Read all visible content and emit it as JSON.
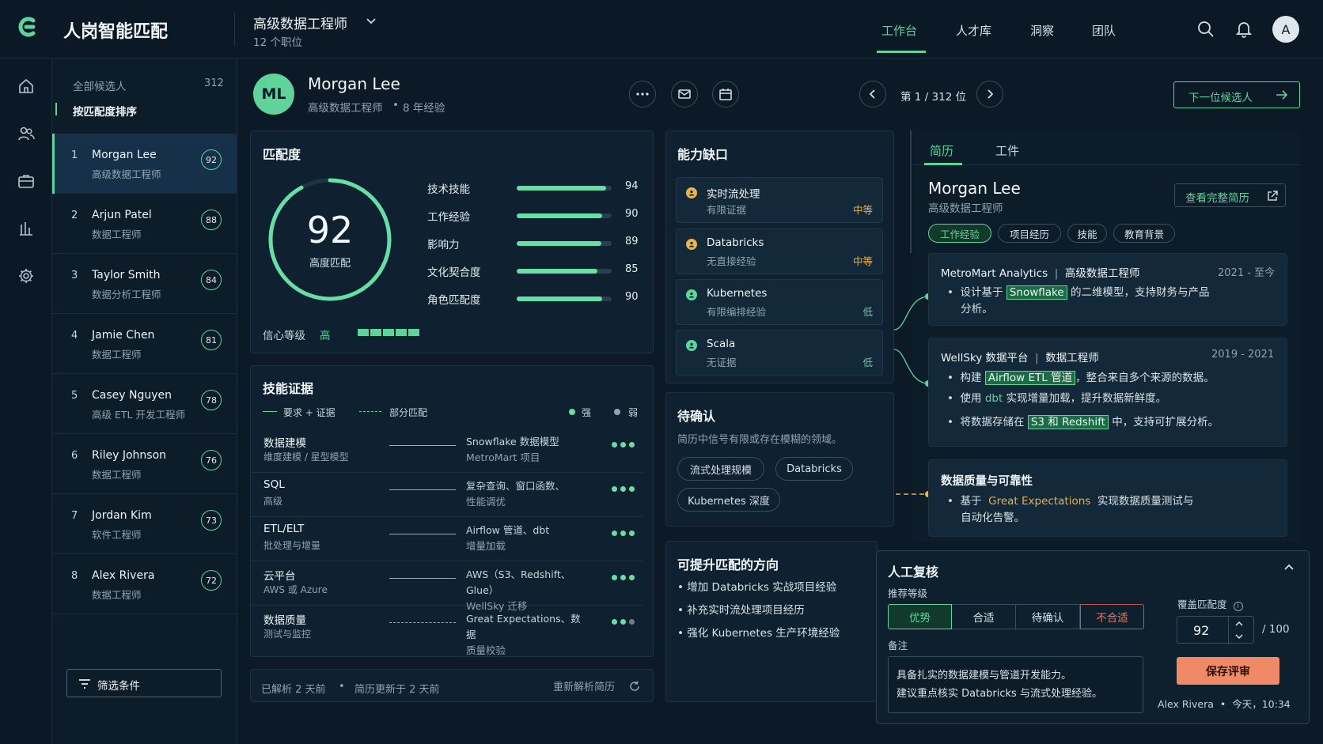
{
  "app": {
    "name": "人岗智能匹配"
  },
  "job": {
    "title": "高级数据工程师",
    "subtitle": "12 个职位"
  },
  "nav": {
    "items": [
      "工作台",
      "人才库",
      "洞察",
      "团队"
    ],
    "active": 0
  },
  "user": {
    "avatar": "A"
  },
  "sidebar_icons": [
    "home-icon",
    "users-icon",
    "briefcase-icon",
    "chart-icon",
    "gear-icon"
  ],
  "candidates_panel": {
    "all_label": "全部候选人",
    "count": "312",
    "sort_label": "按匹配度排序",
    "filter_label": "筛选条件",
    "list": [
      {
        "rank": "1",
        "name": "Morgan Lee",
        "role": "高级数据工程师",
        "score": "92"
      },
      {
        "rank": "2",
        "name": "Arjun Patel",
        "role": "数据工程师",
        "score": "88"
      },
      {
        "rank": "3",
        "name": "Taylor Smith",
        "role": "数据分析工程师",
        "score": "84"
      },
      {
        "rank": "4",
        "name": "Jamie Chen",
        "role": "数据工程师",
        "score": "81"
      },
      {
        "rank": "5",
        "name": "Casey Nguyen",
        "role": "高级 ETL 开发工程师",
        "score": "78"
      },
      {
        "rank": "6",
        "name": "Riley Johnson",
        "role": "数据工程师",
        "score": "76"
      },
      {
        "rank": "7",
        "name": "Jordan Kim",
        "role": "软件工程师",
        "score": "73"
      },
      {
        "rank": "8",
        "name": "Alex Rivera",
        "role": "数据工程师",
        "score": "72"
      }
    ]
  },
  "candidate": {
    "initials": "ML",
    "name": "Morgan Lee",
    "role": "高级数据工程师",
    "experience": "8 年经验",
    "pager": "第 1 / 312 位",
    "next_label": "下一位候选人"
  },
  "match": {
    "title": "匹配度",
    "score": 92,
    "score_text": "92",
    "score_label": "高度匹配",
    "confidence_label": "信心等级",
    "confidence_value": "高",
    "confidence_segments": 5,
    "bars": [
      {
        "label": "技术技能",
        "value": 94,
        "value_text": "94"
      },
      {
        "label": "工作经验",
        "value": 90,
        "value_text": "90"
      },
      {
        "label": "影响力",
        "value": 89,
        "value_text": "89"
      },
      {
        "label": "文化契合度",
        "value": 85,
        "value_text": "85"
      },
      {
        "label": "角色匹配度",
        "value": 90,
        "value_text": "90"
      }
    ]
  },
  "evidence": {
    "title": "技能证据",
    "legend_solid": "要求 + 证据",
    "legend_dashed": "部分匹配",
    "legend_strong": "强",
    "legend_weak": "弱",
    "rows": [
      {
        "skill": "数据建模",
        "sub": "维度建模 / 星型模型",
        "ev1": "Snowflake 数据模型",
        "ev2": "MetroMart 项目",
        "strength": 3
      },
      {
        "skill": "SQL",
        "sub": "高级",
        "ev1": "复杂查询、窗口函数、",
        "ev2": "性能调优",
        "strength": 3
      },
      {
        "skill": "ETL/ELT",
        "sub": "批处理与增量",
        "ev1": "Airflow 管道、dbt",
        "ev2": "增量加载",
        "strength": 3
      },
      {
        "skill": "云平台",
        "sub": "AWS 或 Azure",
        "ev1": "AWS（S3、Redshift、Glue）",
        "ev2": "WellSky 迁移",
        "strength": 3
      },
      {
        "skill": "数据质量",
        "sub": "测试与监控",
        "ev1": "Great Expectations、数据",
        "ev2": "质量校验",
        "strength": 2
      }
    ],
    "footer_parsed": "已解析 2 天前",
    "footer_updated": "简历更新于 2 天前",
    "reparse_label": "重新解析简历"
  },
  "gaps": {
    "title": "能力缺口",
    "items": [
      {
        "name": "实时流处理",
        "desc": "有限证据",
        "level": "中等",
        "color": "#e5b450"
      },
      {
        "name": "Databricks",
        "desc": "无直接经验",
        "level": "中等",
        "color": "#e5b450"
      },
      {
        "name": "Kubernetes",
        "desc": "有限编排经验",
        "level": "低",
        "color": "#5fd39a"
      },
      {
        "name": "Scala",
        "desc": "无证据",
        "level": "低",
        "color": "#5fd39a"
      }
    ]
  },
  "pending": {
    "title": "待确认",
    "desc": "简历中信号有限或存在模糊的领域。",
    "chips": [
      "流式处理规模",
      "Databricks",
      "Kubernetes 深度"
    ]
  },
  "improve": {
    "title": "可提升匹配的方向",
    "items": [
      "增加 Databricks 实战项目经验",
      "补充实时流处理项目经历",
      "强化 Kubernetes 生产环境经验"
    ]
  },
  "resume": {
    "tabs": [
      "简历",
      "工件"
    ],
    "name": "Morgan Lee",
    "role": "高级数据工程师",
    "view_full": "查看完整简历",
    "filters": [
      "工作经验",
      "项目经历",
      "技能",
      "教育背景"
    ],
    "jobs": [
      {
        "company": "MetroMart Analytics",
        "title": "高级数据工程师",
        "period": "2021 - 至今",
        "b1_pre": "设计基于",
        "b1_hl": "Snowflake",
        "b1_post": "的二维模型，支持财务与产品",
        "b1_cont": "分析。"
      },
      {
        "company": "WellSky 数据平台",
        "title": "数据工程师",
        "period": "2019 - 2021",
        "b1_pre": "构建",
        "b1_hl": "Airflow ETL 管道",
        "b1_post": "，整合来自多个来源的数据。",
        "b2_pre": "使用",
        "b2_hl": "dbt",
        "b2_post": "实现增量加载，提升数据新鲜度。",
        "b3_pre": "将数据存储在",
        "b3_hl": "S3 和 Redshift",
        "b3_post": "中，支持可扩展分析。"
      }
    ],
    "quality_title": "数据质量与可靠性",
    "quality_pre": "基于",
    "quality_hl": "Great Expectations",
    "quality_post": "实现数据质量测试与",
    "quality_cont": "自动化告警。"
  },
  "review": {
    "title": "人工复核",
    "level_label": "推荐等级",
    "levels": [
      "优势",
      "合适",
      "待确认",
      "不合适"
    ],
    "override_label": "覆盖匹配度",
    "override_value": "92",
    "override_max": "/ 100",
    "notes_label": "备注",
    "notes_line1": "具备扎实的数据建模与管道开发能力。",
    "notes_line2": "建议重点核实 Databricks 与流式处理经验。",
    "save_label": "保存评审",
    "reviewer": "Alex Rivera",
    "time": "今天，10:34"
  }
}
